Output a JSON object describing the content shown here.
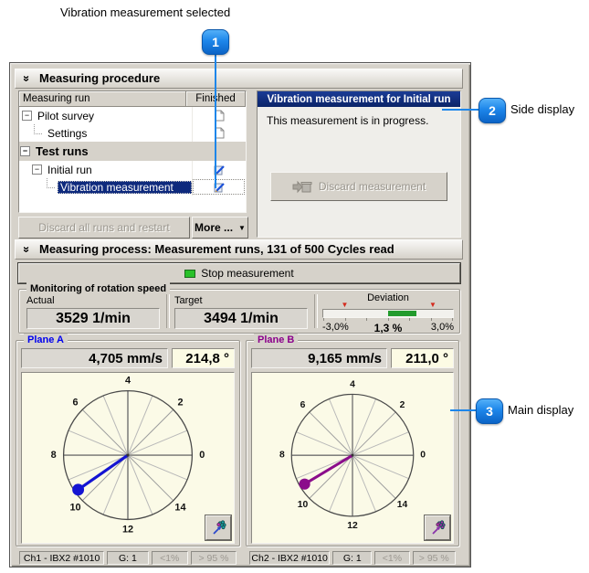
{
  "annotation": {
    "title": "Vibration measurement selected",
    "callout1_num": "1",
    "callout2_num": "2",
    "callout2_label": "Side display",
    "callout3_num": "3",
    "callout3_label": "Main display"
  },
  "icons": {
    "collapse_chevron": "»",
    "dropdown_arrow": "▼",
    "deviation_marker": "▼",
    "expander_minus": "−"
  },
  "colors": {
    "callout_accent": "#1d86ea",
    "selection": "#0e2a7d",
    "deviation_green": "#239b2d",
    "stop_led_green": "#29c129",
    "marker_red": "#d42b1e"
  },
  "procedure": {
    "header": "Measuring procedure",
    "columns": {
      "run": "Measuring run",
      "finished": "Finished"
    },
    "rows": [
      {
        "label": "Pilot survey"
      },
      {
        "label": "Settings"
      },
      {
        "label": "Test runs"
      },
      {
        "label": "Initial run"
      },
      {
        "label": "Vibration measurement"
      }
    ],
    "discard_all_button": "Discard all runs and restart",
    "more_button": "More ...",
    "side_panel": {
      "title": "Vibration measurement for Initial run",
      "message": "This measurement is in progress.",
      "discard_button": "Discard measurement"
    }
  },
  "process": {
    "header": "Measuring process: Measurement runs, 131 of 500 Cycles read",
    "stop_button": "Stop measurement",
    "monitoring": {
      "title": "Monitoring of rotation speed",
      "actual_label": "Actual",
      "actual_value": "3529 1/min",
      "target_label": "Target",
      "target_value": "3494 1/min",
      "deviation_label": "Deviation",
      "min_label": "-3,0%",
      "value_label": "1,3 %",
      "max_label": "3,0%",
      "deviation_percent": 1.3,
      "range_percent": 3.0,
      "marker_low_frac": 0.17,
      "marker_high_frac": 0.84
    }
  },
  "chart_data": [
    {
      "type": "polar",
      "name": "Plane A",
      "magnitude_label": "4,705 mm/s",
      "phase_label": "214,8 °",
      "magnitude": 4.705,
      "unit": "mm/s",
      "phase_deg": 214.8,
      "full_scale": 5.0,
      "divisions": 16,
      "division_labels": [
        "0",
        "2",
        "4",
        "6",
        "8",
        "10",
        "12",
        "14"
      ],
      "direction": "counterclockwise",
      "vector_color": "#1414d2",
      "label_color": "#0000ee",
      "wand_line_color": "#2a48cc",
      "wand_dot_color": "#1fa8a8",
      "wand_accent_color": "#c030c0",
      "status": [
        "Ch1 - IBX2 #1010",
        "G: 1",
        "<1%",
        "> 95 %"
      ]
    },
    {
      "type": "polar",
      "name": "Plane B",
      "magnitude_label": "9,165 mm/s",
      "phase_label": "211,0 °",
      "magnitude": 9.165,
      "unit": "mm/s",
      "phase_deg": 211.0,
      "full_scale": 10.0,
      "divisions": 16,
      "division_labels": [
        "0",
        "2",
        "4",
        "6",
        "8",
        "10",
        "12",
        "14"
      ],
      "direction": "counterclockwise",
      "vector_color": "#8b0d8b",
      "label_color": "#8b008b",
      "wand_line_color": "#8833aa",
      "wand_dot_color": "#b02ab0",
      "wand_accent_color": "#b02ab0",
      "status": [
        "Ch2 - IBX2 #1010",
        "G: 1",
        "<1%",
        "> 95 %"
      ]
    }
  ]
}
